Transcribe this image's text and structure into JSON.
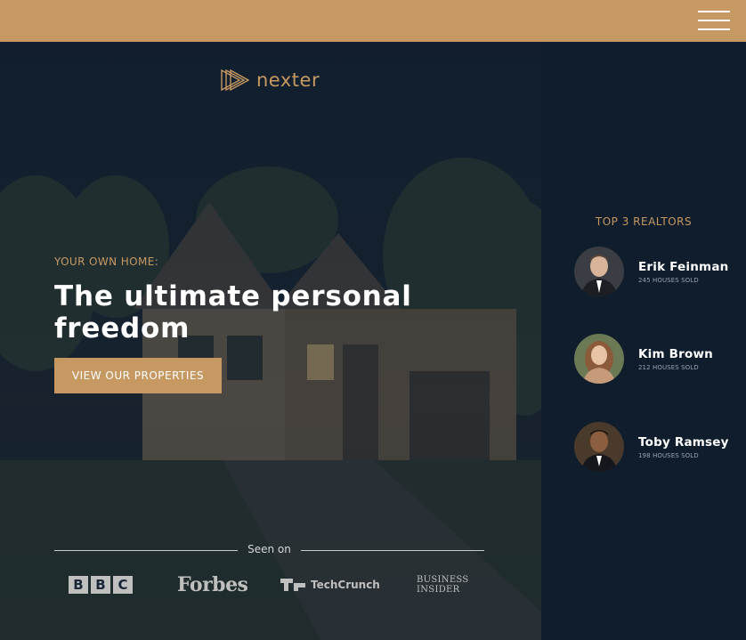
{
  "header": {
    "bar_color": "#c69963",
    "menu_icon": "hamburger-icon"
  },
  "hero": {
    "logo_text": "nexter",
    "logo_icon": "triple-play-icon",
    "eyebrow": "YOUR OWN HOME:",
    "headline": "The ultimate personal freedom",
    "cta_label": "VIEW OUR PROPERTIES",
    "accent_color": "#c69963"
  },
  "seen_on": {
    "label": "Seen on",
    "logos": {
      "bbc": [
        "B",
        "B",
        "C"
      ],
      "forbes": "Forbes",
      "techcrunch": "TechCrunch",
      "business_insider_line1": "BUSINESS",
      "business_insider_line2": "INSIDER"
    }
  },
  "sidebar": {
    "title": "TOP 3 REALTORS",
    "realtors": [
      {
        "name": "Erik Feinman",
        "sold": "245 HOUSES SOLD"
      },
      {
        "name": "Kim Brown",
        "sold": "212 HOUSES SOLD"
      },
      {
        "name": "Toby Ramsey",
        "sold": "198 HOUSES SOLD"
      }
    ]
  }
}
